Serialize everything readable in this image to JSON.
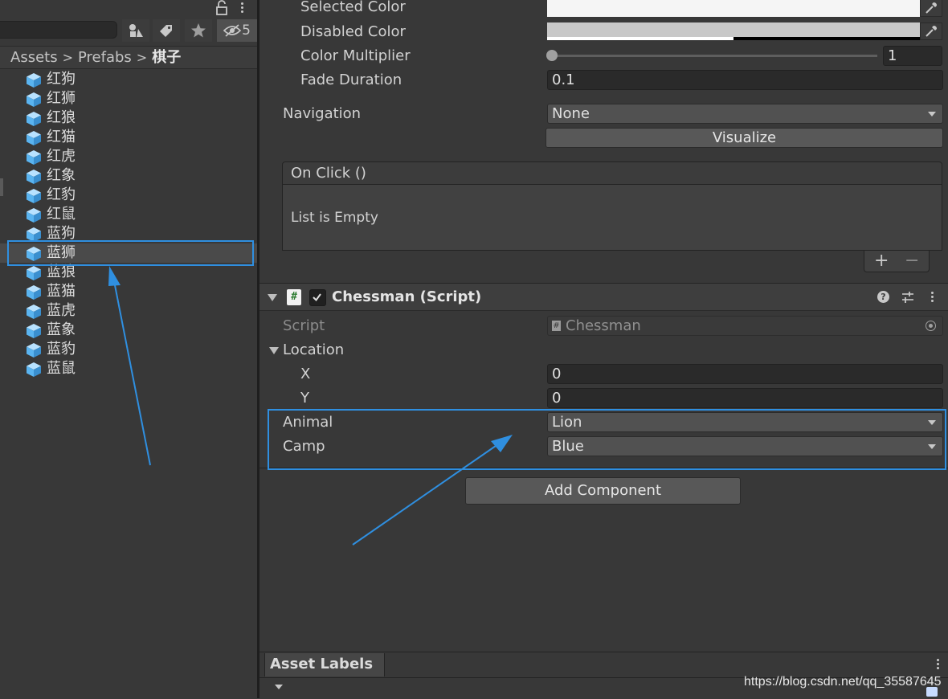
{
  "project_panel": {
    "hidden_count": "5",
    "breadcrumb": [
      "Assets",
      "Prefabs"
    ],
    "breadcrumb_current": "棋子",
    "assets": [
      "红狗",
      "红狮",
      "红狼",
      "红猫",
      "红虎",
      "红象",
      "红豹",
      "红鼠",
      "蓝狗",
      "蓝狮",
      "蓝狼",
      "蓝猫",
      "蓝虎",
      "蓝象",
      "蓝豹",
      "蓝鼠"
    ],
    "selected_index": 9,
    "icon": "prefab-cube-icon"
  },
  "button_fields": {
    "selected_color_label": "Selected Color",
    "disabled_color_label": "Disabled Color",
    "color_multiplier_label": "Color Multiplier",
    "color_multiplier_value": "1",
    "fade_duration_label": "Fade Duration",
    "fade_duration_value": "0.1",
    "navigation_label": "Navigation",
    "navigation_value": "None",
    "visualize_label": "Visualize",
    "onclick_title": "On Click ()",
    "onclick_empty": "List is Empty",
    "add_symbol": "+",
    "remove_symbol": "−"
  },
  "component": {
    "title": "Chessman (Script)",
    "script_label": "Script",
    "script_value": "Chessman",
    "location_label": "Location",
    "x_label": "X",
    "x_value": "0",
    "y_label": "Y",
    "y_value": "0",
    "animal_label": "Animal",
    "animal_value": "Lion",
    "camp_label": "Camp",
    "camp_value": "Blue"
  },
  "add_component_label": "Add Component",
  "asset_labels_label": "Asset Labels",
  "watermark": "https://blog.csdn.net/qq_35587645",
  "colors": {
    "highlight": "#2f8fe0",
    "selected_color": "#f5f5f5",
    "disabled_color": "#c8c8c8",
    "prefab_icon": "#5ab4f0"
  }
}
